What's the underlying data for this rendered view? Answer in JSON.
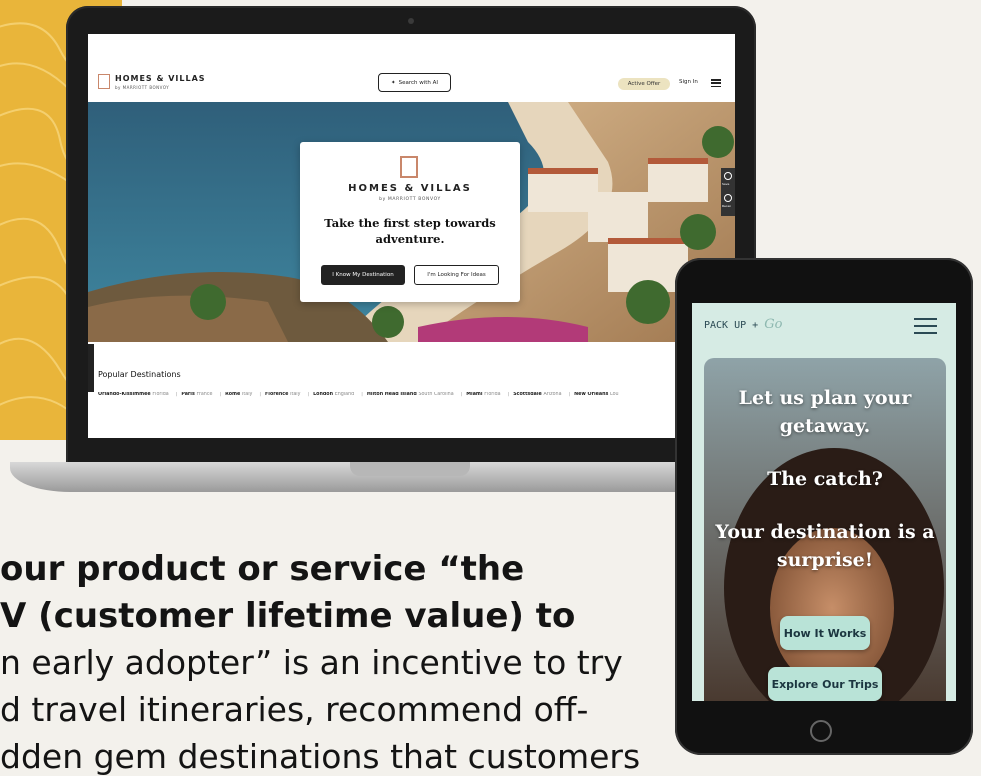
{
  "laptop_site": {
    "logo_name": "HOMES & VILLAS",
    "logo_sub": "by MARRIOTT BONVOY",
    "search_ai_label": "Search with AI",
    "active_offer_label": "Active Offer",
    "sign_in_label": "Sign In",
    "card_logo_name": "HOMES & VILLAS",
    "card_logo_sub": "by MARRIOTT BONVOY",
    "card_heading": "Take the first step towards adventure.",
    "btn_know_destination": "I Know My Destination",
    "btn_looking_ideas": "I'm Looking For Ideas",
    "side_save_label": "Save",
    "side_recent_label": "Recen",
    "popular_title": "Popular Destinations",
    "destinations": [
      {
        "city": "Orlando-Kissimmee",
        "region": "Florida"
      },
      {
        "city": "Paris",
        "region": "France"
      },
      {
        "city": "Rome",
        "region": "Italy"
      },
      {
        "city": "Florence",
        "region": "Italy"
      },
      {
        "city": "London",
        "region": "England"
      },
      {
        "city": "Hilton Head Island",
        "region": "South Carolina"
      },
      {
        "city": "Miami",
        "region": "Florida"
      },
      {
        "city": "Scottsdale",
        "region": "Arizona"
      },
      {
        "city": "New Orleans",
        "region": "Lou"
      }
    ]
  },
  "tablet_site": {
    "logo_main": "PACK UP +",
    "logo_go": "Go",
    "headline_1": "Let us plan your getaway.",
    "headline_2": "The catch?",
    "headline_3": "Your destination is a surprise!",
    "btn_how": "How It Works",
    "btn_explore": "Explore Our Trips"
  },
  "body_text": {
    "line1": "our product or service “the",
    "line2": "V (customer lifetime value) to",
    "line3": "n early adopter” is an incentive to try",
    "line4": "d travel itineraries, recommend off-",
    "line5": "dden gem destinations that customers"
  },
  "colors": {
    "yellow_panel": "#e9b53a",
    "brand_copper": "#c9876b",
    "mint_button": "#b9e3d7",
    "offer_pill": "#ece3c0"
  }
}
